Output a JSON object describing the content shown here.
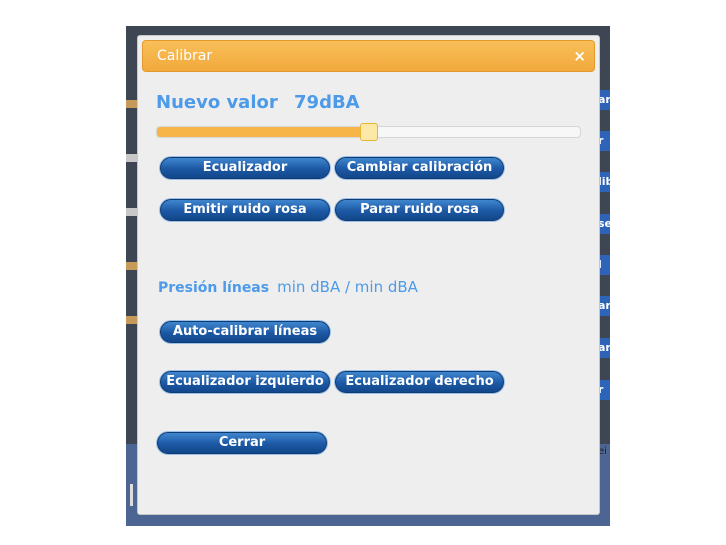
{
  "dialog": {
    "title": "Calibrar",
    "close_icon": "close-icon"
  },
  "calibration": {
    "new_value_label": "Nuevo valor",
    "new_value": "79dBA",
    "slider_level": 0.5
  },
  "buttons": {
    "equalizer": "Ecualizador",
    "change_calibration": "Cambiar calibración",
    "emit_pink_noise": "Emitir ruido rosa",
    "stop_pink_noise": "Parar ruido rosa",
    "auto_calibrate_lines": "Auto-calibrar líneas",
    "left_equalizer": "Ecualizador izquierdo",
    "right_equalizer": "Ecualizador derecho",
    "close": "Cerrar"
  },
  "lines": {
    "pressure_label": "Presión líneas",
    "pressure_value": "min dBA / min dBA"
  },
  "background": {
    "right_fragments": [
      "ar",
      "r",
      "lib",
      "se",
      "l c",
      "ar",
      "ar",
      "ar",
      "r s"
    ],
    "right_text": "ei"
  },
  "colors": {
    "accent": "#f7b447",
    "title_bar": "#f2a93c",
    "button": "#1c58a4",
    "label_text": "#4d9be8"
  }
}
